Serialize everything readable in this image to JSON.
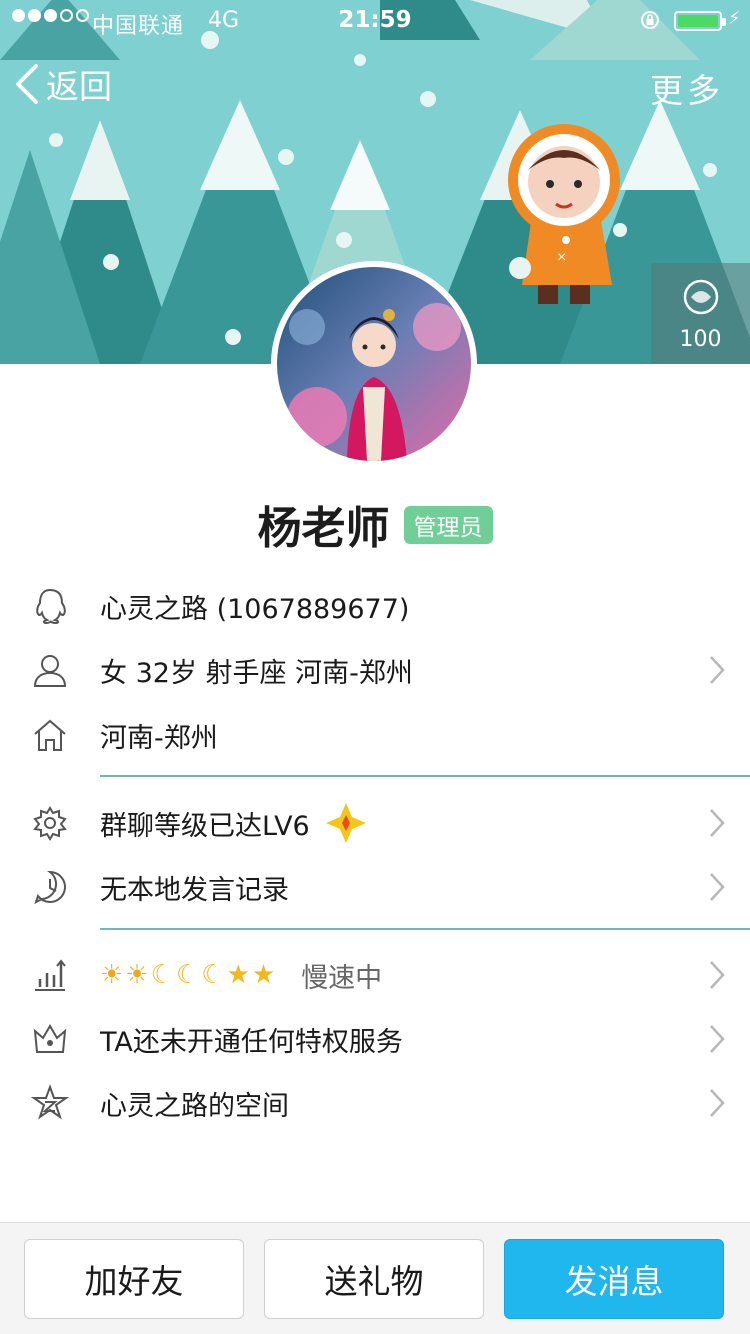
{
  "status_bar": {
    "carrier": "中国联通",
    "network": "4G",
    "time": "21:59"
  },
  "nav": {
    "back_label": "返回",
    "more_label": "更多"
  },
  "side_badge": {
    "count": "100"
  },
  "profile": {
    "name": "杨老师",
    "role_badge": "管理员"
  },
  "info": {
    "qq": "心灵之路 (1067889677)",
    "personal": "女 32岁 射手座 河南-郑州",
    "hometown": "河南-郑州",
    "group_level": "群聊等级已达LV6",
    "chat_record": "无本地发言记录",
    "level_icons": [
      "sun-icon",
      "sun-icon",
      "moon-icon",
      "moon-icon",
      "moon-icon",
      "star-icon",
      "star-icon"
    ],
    "level_speed": "慢速中",
    "privilege": "TA还未开通任何特权服务",
    "space": "心灵之路的空间"
  },
  "actions": {
    "add_friend": "加好友",
    "send_gift": "送礼物",
    "send_message": "发消息"
  },
  "colors": {
    "banner": "#7fd0d0",
    "role_badge": "#6fcf97",
    "primary": "#20b6ee",
    "divider": "#6fb7b0"
  }
}
